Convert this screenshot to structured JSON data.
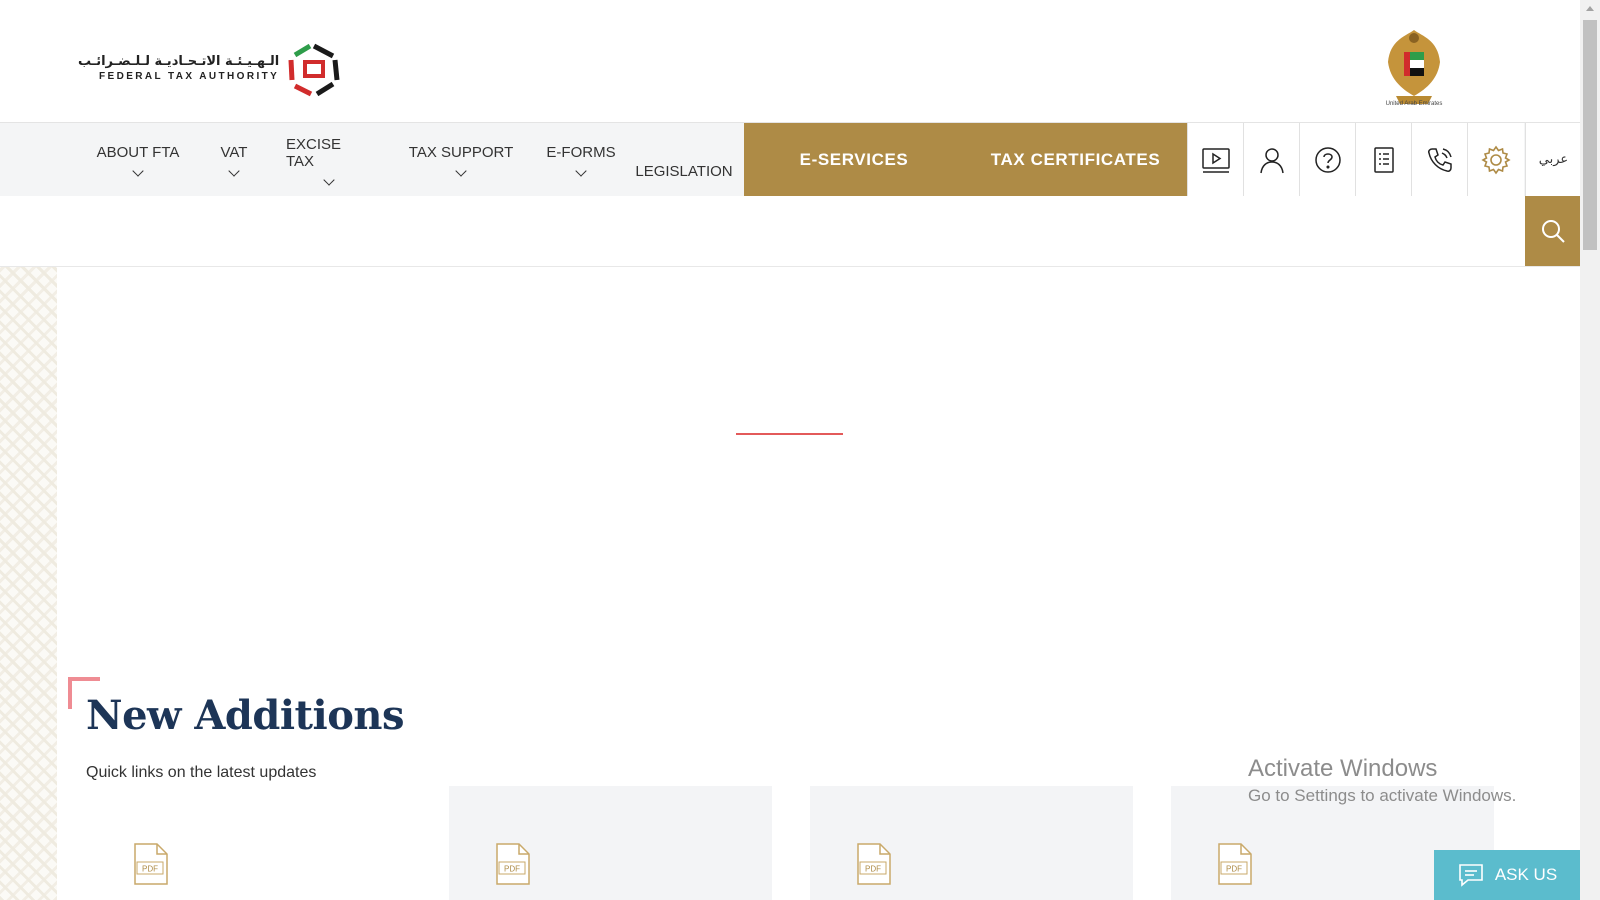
{
  "header": {
    "logo_ar": "الـهـيـئـة الاتـحـاديـة لـلـضـرائـب",
    "logo_en": "FEDERAL TAX AUTHORITY",
    "emblem_caption": "United Arab Emirates"
  },
  "nav": {
    "items": [
      {
        "label": "ABOUT FTA",
        "has_dropdown": true
      },
      {
        "label": "VAT",
        "has_dropdown": true
      },
      {
        "label": "EXCISE TAX",
        "has_dropdown": true
      },
      {
        "label": "TAX SUPPORT",
        "has_dropdown": true
      },
      {
        "label": "E-FORMS",
        "has_dropdown": true
      },
      {
        "label": "LEGISLATION",
        "has_dropdown": false
      }
    ],
    "eservices_label": "E-SERVICES",
    "tax_certificates_label": "TAX CERTIFICATES",
    "icons": [
      "video-icon",
      "user-icon",
      "help-icon",
      "document-list-icon",
      "phone-icon",
      "settings-icon"
    ],
    "language_label": "عربي"
  },
  "search": {
    "placeholder": ""
  },
  "new_additions": {
    "title": "New Additions",
    "subtitle": "Quick links on the latest updates",
    "card_icon": "pdf-icon",
    "pdf_label": "PDF"
  },
  "watermark": {
    "line1": "Activate Windows",
    "line2": "Go to Settings to activate Windows."
  },
  "ask_us": {
    "label": "ASK US"
  },
  "colors": {
    "gold": "#ae8b46",
    "navy": "#1d3557",
    "teal": "#5bbccd",
    "accent_red": "#e35a5a",
    "pink": "#ef8c93"
  }
}
